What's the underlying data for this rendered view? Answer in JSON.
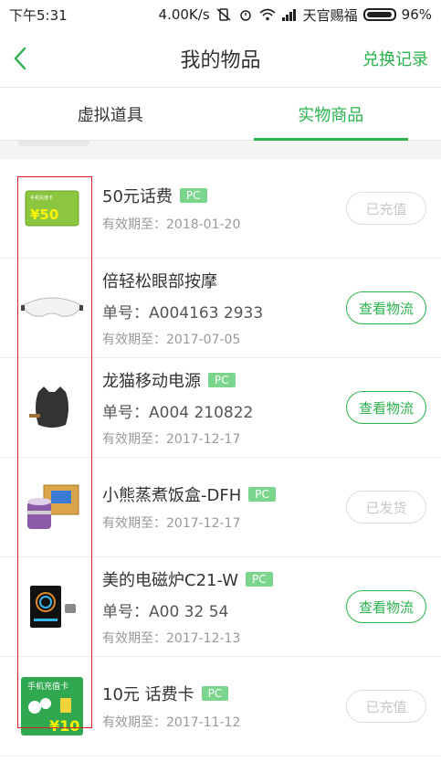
{
  "status_bar": {
    "time": "下午5:31",
    "speed": "4.00K/s",
    "carrier": "天官赐福",
    "battery": "96%"
  },
  "header": {
    "title": "我的物品",
    "right_link": "兑换记录"
  },
  "tabs": [
    {
      "label": "虚拟道具",
      "active": false
    },
    {
      "label": "实物商品",
      "active": true
    }
  ],
  "colors": {
    "accent": "#2bb24c",
    "badge": "#7bd58d",
    "highlight_box": "#d81e1e"
  },
  "items": [
    {
      "name": "50元话费",
      "badge": "PC",
      "order": "",
      "expiry": "有效期至：2018-01-20",
      "action": "已充值",
      "action_state": "disabled",
      "thumb_icon": "phone-card-50-icon",
      "card_label": "手机充值卡",
      "card_value": "¥50"
    },
    {
      "name": "倍轻松眼部按摩",
      "badge": "",
      "order": "单号：A004163  2933",
      "expiry": "有效期至：2017-07-05",
      "action": "查看物流",
      "action_state": "primary",
      "thumb_icon": "eye-massager-icon"
    },
    {
      "name": "龙猫移动电源",
      "badge": "PC",
      "order": "单号：A004  210822",
      "expiry": "有效期至：2017-12-17",
      "action": "查看物流",
      "action_state": "primary",
      "thumb_icon": "power-bank-icon"
    },
    {
      "name": "小熊蒸煮饭盒-DFH",
      "badge": "PC",
      "order": "",
      "expiry": "有效期至：2017-12-17",
      "action": "已发货",
      "action_state": "disabled",
      "thumb_icon": "lunch-box-icon"
    },
    {
      "name": "美的电磁炉C21-W",
      "badge": "PC",
      "order": "单号：A00  32  54",
      "expiry": "有效期至：2017-12-13",
      "action": "查看物流",
      "action_state": "primary",
      "thumb_icon": "induction-cooker-icon"
    },
    {
      "name": "10元 话费卡",
      "badge": "PC",
      "order": "",
      "expiry": "有效期至：2017-11-12",
      "action": "已充值",
      "action_state": "disabled",
      "thumb_icon": "phone-card-10-icon",
      "card_label": "手机充值卡",
      "card_value": "¥10"
    }
  ]
}
